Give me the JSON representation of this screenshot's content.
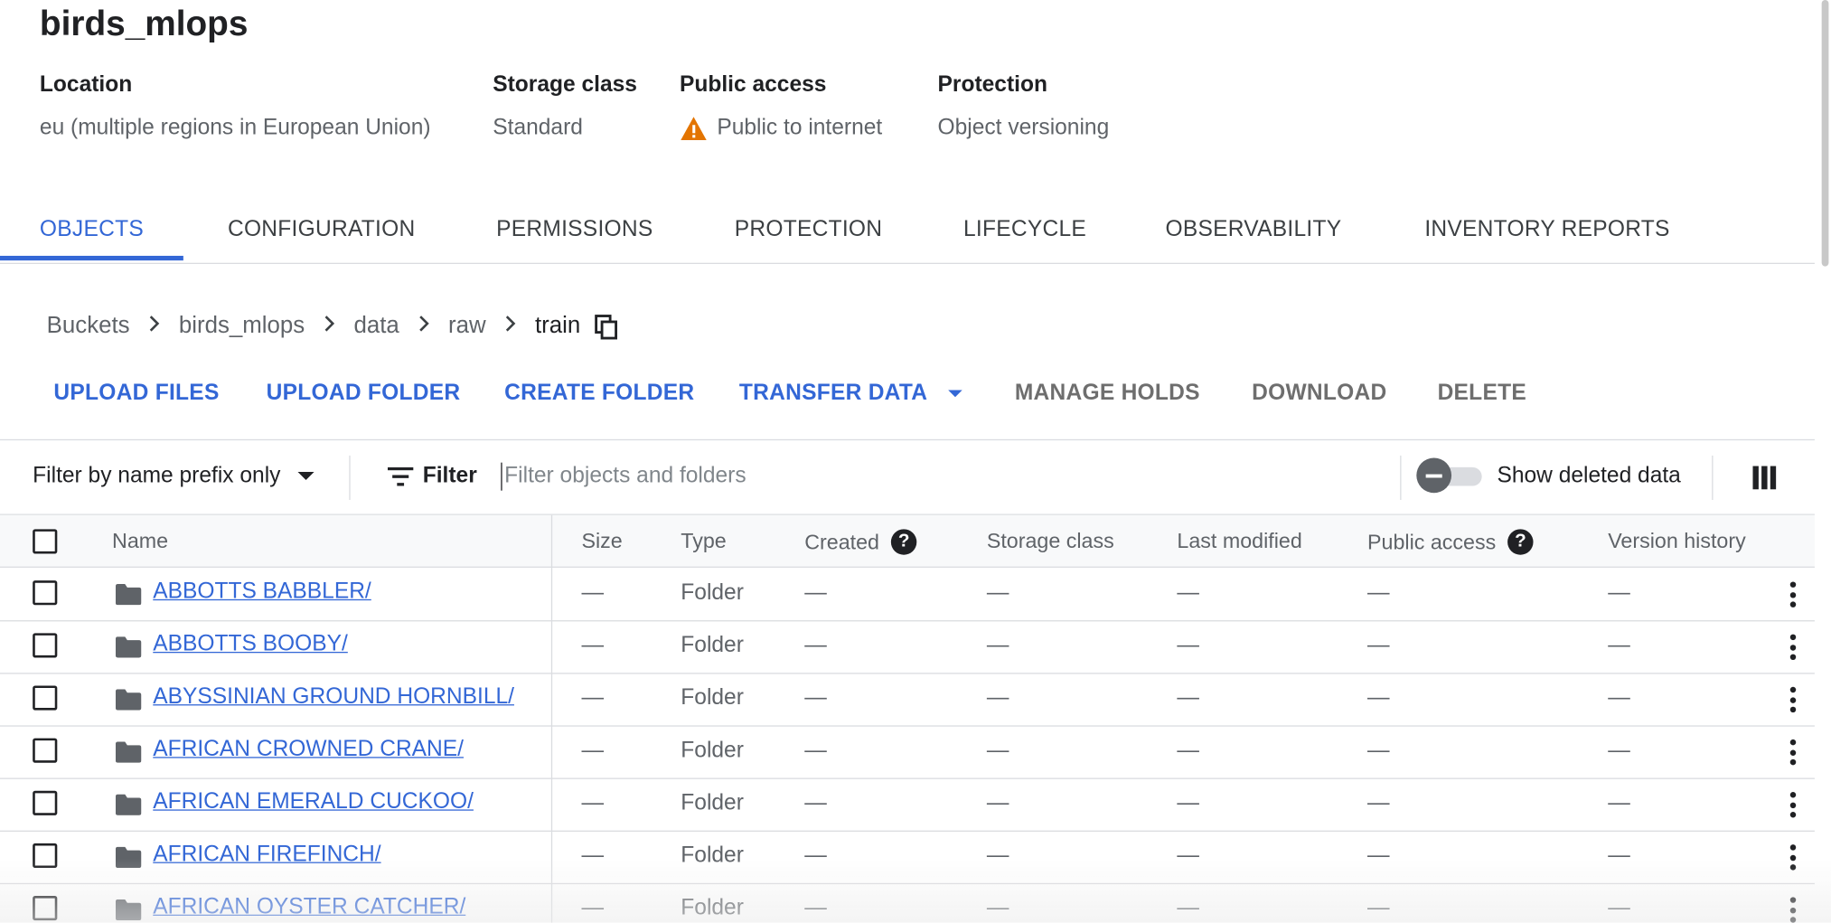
{
  "bucket": {
    "name": "birds_mlops",
    "location_label": "Location",
    "location_value": "eu (multiple regions in European Union)",
    "storage_label": "Storage class",
    "storage_value": "Standard",
    "public_label": "Public access",
    "public_value": "Public to internet",
    "protection_label": "Protection",
    "protection_value": "Object versioning"
  },
  "tabs": [
    {
      "label": "OBJECTS",
      "active": true
    },
    {
      "label": "CONFIGURATION"
    },
    {
      "label": "PERMISSIONS"
    },
    {
      "label": "PROTECTION"
    },
    {
      "label": "LIFECYCLE"
    },
    {
      "label": "OBSERVABILITY"
    },
    {
      "label": "INVENTORY REPORTS"
    }
  ],
  "breadcrumb": [
    "Buckets",
    "birds_mlops",
    "data",
    "raw",
    "train"
  ],
  "actions": {
    "upload_files": "UPLOAD FILES",
    "upload_folder": "UPLOAD FOLDER",
    "create_folder": "CREATE FOLDER",
    "transfer_data": "TRANSFER DATA",
    "manage_holds": "MANAGE HOLDS",
    "download": "DOWNLOAD",
    "delete": "DELETE"
  },
  "filter": {
    "mode": "Filter by name prefix only",
    "label": "Filter",
    "placeholder": "Filter objects and folders",
    "show_deleted": "Show deleted data",
    "show_deleted_on": false
  },
  "columns": {
    "name": "Name",
    "size": "Size",
    "type": "Type",
    "created": "Created",
    "storage_class": "Storage class",
    "last_modified": "Last modified",
    "public_access": "Public access",
    "version_history": "Version history"
  },
  "rows": [
    {
      "name": "ABBOTTS BABBLER/",
      "size": "—",
      "type": "Folder",
      "created": "—",
      "storage_class": "—",
      "last_modified": "—",
      "public_access": "—",
      "version_history": "—"
    },
    {
      "name": "ABBOTTS BOOBY/",
      "size": "—",
      "type": "Folder",
      "created": "—",
      "storage_class": "—",
      "last_modified": "—",
      "public_access": "—",
      "version_history": "—"
    },
    {
      "name": "ABYSSINIAN GROUND HORNBILL/",
      "size": "—",
      "type": "Folder",
      "created": "—",
      "storage_class": "—",
      "last_modified": "—",
      "public_access": "—",
      "version_history": "—"
    },
    {
      "name": "AFRICAN CROWNED CRANE/",
      "size": "—",
      "type": "Folder",
      "created": "—",
      "storage_class": "—",
      "last_modified": "—",
      "public_access": "—",
      "version_history": "—"
    },
    {
      "name": "AFRICAN EMERALD CUCKOO/",
      "size": "—",
      "type": "Folder",
      "created": "—",
      "storage_class": "—",
      "last_modified": "—",
      "public_access": "—",
      "version_history": "—"
    },
    {
      "name": "AFRICAN FIREFINCH/",
      "size": "—",
      "type": "Folder",
      "created": "—",
      "storage_class": "—",
      "last_modified": "—",
      "public_access": "—",
      "version_history": "—"
    },
    {
      "name": "AFRICAN OYSTER CATCHER/",
      "size": "—",
      "type": "Folder",
      "created": "—",
      "storage_class": "—",
      "last_modified": "—",
      "public_access": "—",
      "version_history": "—"
    }
  ],
  "colors": {
    "accent": "#3367d6",
    "warning": "#e37400",
    "muted_text": "#5f6368",
    "divider": "#dadce0"
  },
  "icons": {
    "copy": "copy-icon",
    "warning": "warning-icon",
    "filter": "filter-list-icon",
    "folder": "folder-icon",
    "columns": "column-display-icon",
    "more": "more-vert-icon",
    "help": "help-icon",
    "chevron": "chevron-right-icon",
    "dropdown": "arrow-drop-down-icon"
  }
}
